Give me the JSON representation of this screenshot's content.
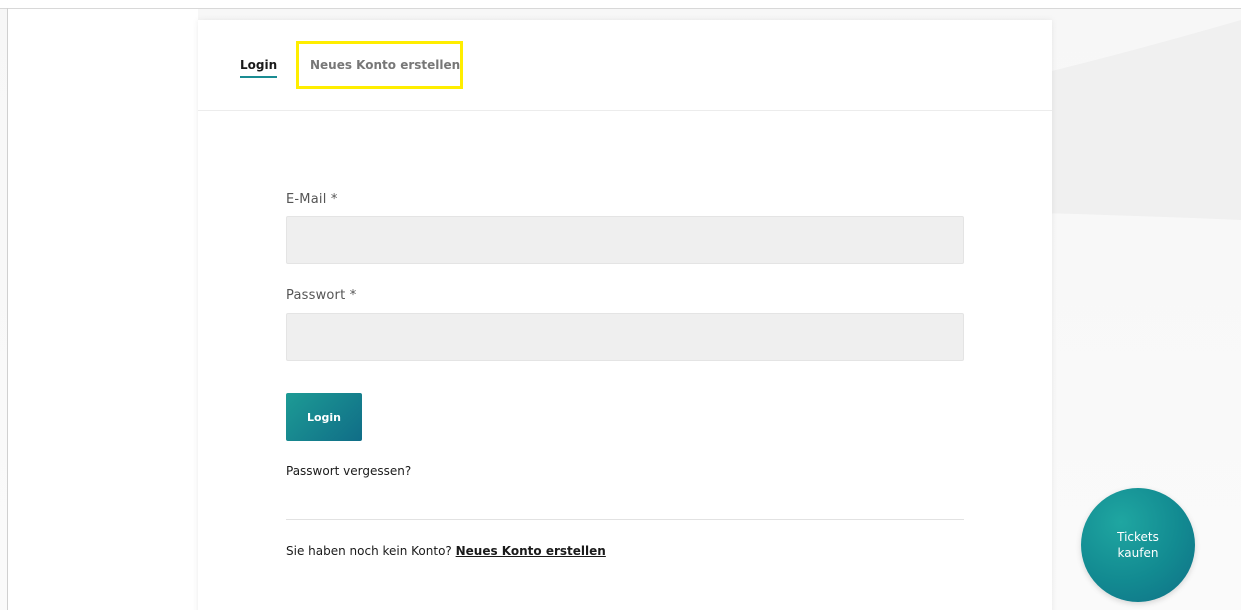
{
  "tabs": {
    "login_label": "Login",
    "register_label": "Neues Konto erstellen",
    "active": "Login"
  },
  "form": {
    "email_label": "E-Mail *",
    "email_value": "",
    "password_label": "Passwort *",
    "password_value": "",
    "submit_label": "Login",
    "forgot_label": "Passwort vergessen?"
  },
  "footer": {
    "prompt": "Sie haben noch kein Konto?",
    "register_link": "Neues Konto erstellen"
  },
  "fab": {
    "line1": "Tickets",
    "line2": "kaufen"
  },
  "colors": {
    "accent": "#1a8c92",
    "highlight": "#ffee00",
    "input_bg": "#efefef"
  }
}
